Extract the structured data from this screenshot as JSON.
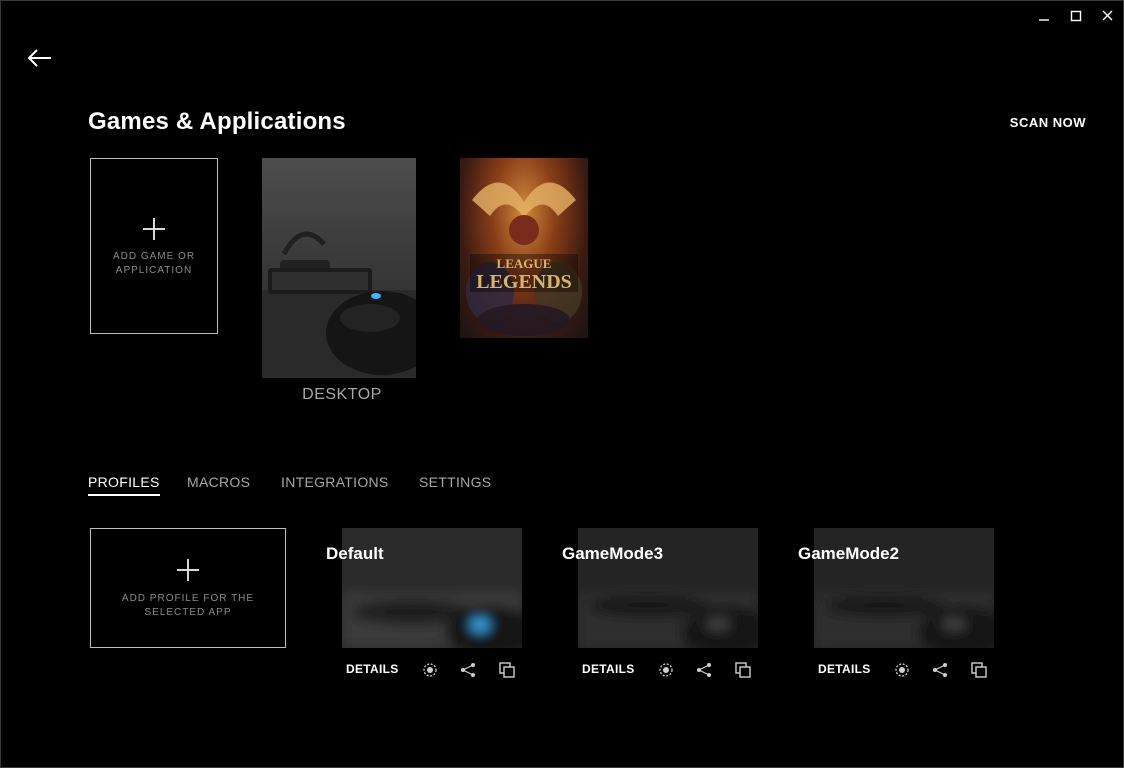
{
  "header": {
    "title": "Games & Applications",
    "scan_label": "SCAN NOW"
  },
  "games": {
    "add_label": "ADD GAME OR APPLICATION",
    "items": [
      {
        "label": "DESKTOP"
      },
      {
        "label": "LEAGUE OF LEGENDS"
      }
    ]
  },
  "tabs": [
    {
      "label": "PROFILES",
      "active": true
    },
    {
      "label": "MACROS"
    },
    {
      "label": "INTEGRATIONS"
    },
    {
      "label": "SETTINGS"
    }
  ],
  "profiles": {
    "add_label": "ADD PROFILE FOR THE SELECTED APP",
    "details_label": "DETAILS",
    "items": [
      {
        "name": "Default"
      },
      {
        "name": "GameMode3"
      },
      {
        "name": "GameMode2"
      }
    ]
  },
  "icons": {
    "window": [
      "minimize-icon",
      "maximize-icon",
      "close-icon"
    ],
    "back": "back-arrow-icon",
    "profile_actions": [
      "persistent-profile-icon",
      "share-icon",
      "copy-icon"
    ]
  },
  "colors": {
    "background": "#000000",
    "text": "#ffffff",
    "muted_text": "#a8a8a8",
    "border": "#bdbdbd"
  }
}
